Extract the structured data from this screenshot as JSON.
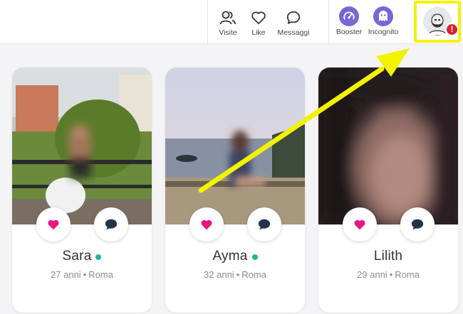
{
  "nav": {
    "items": [
      {
        "label": "Visite",
        "icon": "visitors-icon"
      },
      {
        "label": "Like",
        "icon": "heart-outline-icon"
      },
      {
        "label": "Messaggi",
        "icon": "chat-bubble-icon"
      }
    ],
    "extras": [
      {
        "label": "Booster",
        "icon": "gauge-icon"
      },
      {
        "label": "Incognito",
        "icon": "ghost-icon"
      }
    ],
    "profile": {
      "alert": "!",
      "icon": "user-avatar-icon"
    }
  },
  "colors": {
    "accent_purple": "#7866d6",
    "like_pink": "#e8177f",
    "online_green": "#1bb89a",
    "alert_red": "#e0202c",
    "highlight_yellow": "#f3f200"
  },
  "cards": [
    {
      "name": "Sara",
      "online": true,
      "age": "27 anni",
      "city": "Roma"
    },
    {
      "name": "Ayma",
      "online": true,
      "age": "32 anni",
      "city": "Roma"
    },
    {
      "name": "Lilith",
      "online": false,
      "age": "29 anni",
      "city": "Roma"
    }
  ],
  "separator": "•"
}
